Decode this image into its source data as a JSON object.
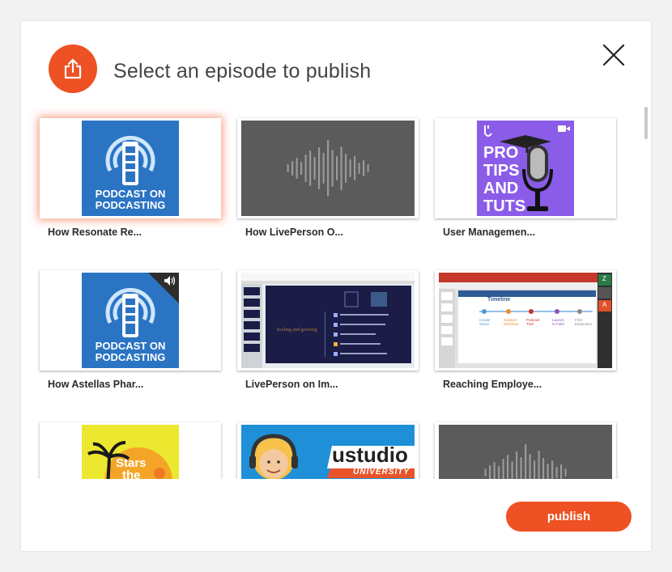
{
  "dialog": {
    "title": "Select an episode to publish",
    "publish_label": "publish",
    "accent_color": "#ee5123"
  },
  "episodes": [
    {
      "label": "How Resonate Re...",
      "thumb": "podcast-on-podcasting",
      "selected": true
    },
    {
      "label": "How LivePerson O...",
      "thumb": "audio-waveform"
    },
    {
      "label": "User Managemen...",
      "thumb": "pro-tips-and-tuts"
    },
    {
      "label": "How Astellas Phar...",
      "thumb": "podcast-on-podcasting"
    },
    {
      "label": "LivePerson on Im...",
      "thumb": "presentation-slide"
    },
    {
      "label": "Reaching Employe...",
      "thumb": "powerpoint-timeline"
    },
    {
      "label": "",
      "thumb": "stars-the-art"
    },
    {
      "label": "",
      "thumb": "ustudio-university"
    },
    {
      "label": "",
      "thumb": "audio-waveform"
    }
  ],
  "art_text": {
    "podcast_line1": "PODCAST ON",
    "podcast_line2": "PODCASTING",
    "tips": [
      "PRO",
      "TIPS",
      "AND",
      "TUTS"
    ],
    "stars": [
      "Stars",
      "the"
    ],
    "ustudio": "ustudio",
    "university": "UNIVERSITY",
    "slide_heading": "Scaling and growing",
    "timeline_title": "Timeline",
    "timeline_steps": [
      "Create Select",
      "Solution Selection",
      "Podcast Trial",
      "Launch to Field",
      "First Expansion"
    ],
    "participants": [
      "Z",
      "A"
    ]
  }
}
